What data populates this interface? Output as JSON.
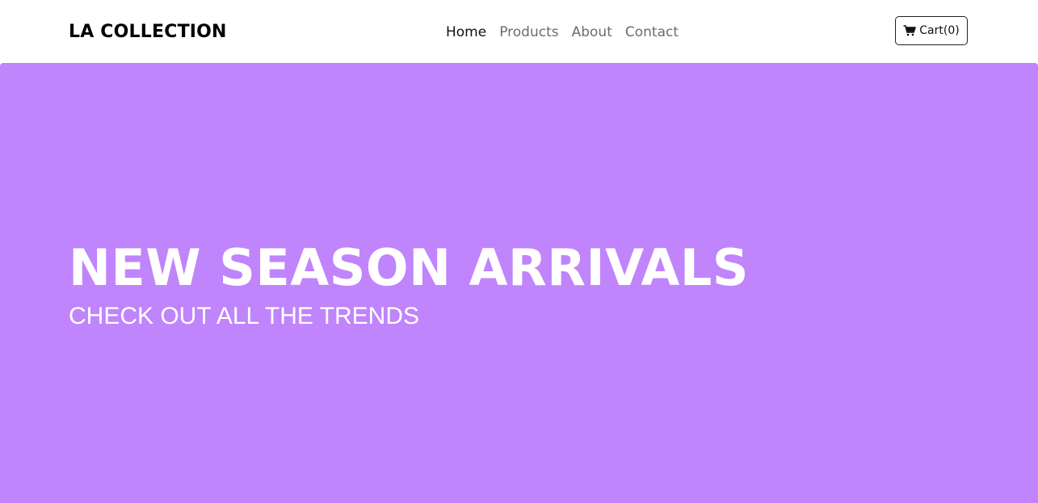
{
  "header": {
    "brand": "LA COLLECTION",
    "nav": [
      {
        "label": "Home",
        "active": true
      },
      {
        "label": "Products",
        "active": false
      },
      {
        "label": "About",
        "active": false
      },
      {
        "label": "Contact",
        "active": false
      }
    ],
    "cart_label": "Cart(0)",
    "cart_icon": "shopping-cart-icon"
  },
  "hero": {
    "title": "NEW SEASON ARRIVALS",
    "subtitle": "CHECK OUT ALL THE TRENDS",
    "background_color": "#c084fc"
  }
}
